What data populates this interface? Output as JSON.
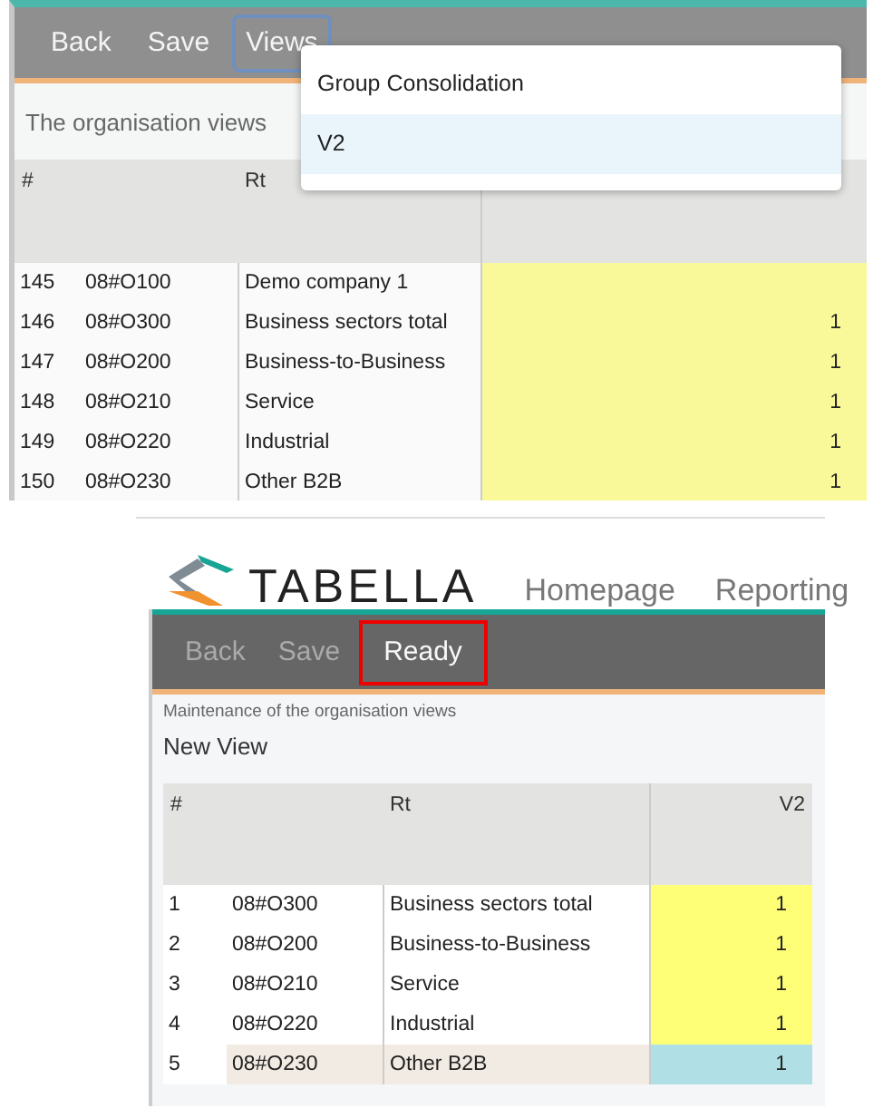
{
  "top_view": {
    "toolbar": [
      {
        "label": "Back",
        "focused": false
      },
      {
        "label": "Save",
        "focused": false
      },
      {
        "label": "Views",
        "focused": true
      }
    ],
    "dropdown": [
      {
        "label": "Group Consolidation",
        "selected": false
      },
      {
        "label": "V2",
        "selected": true
      }
    ],
    "subtitle": "The organisation views",
    "table": {
      "columns": [
        "#",
        "Rt"
      ],
      "rows": [
        {
          "number": "145",
          "code": "08#O100",
          "name": "Demo company 1"
        },
        {
          "number": "146",
          "code": "08#O300",
          "name": "Business sectors total",
          "value": "1"
        },
        {
          "number": "147",
          "code": "08#O200",
          "name": "Business-to-Business",
          "value": "1"
        },
        {
          "number": "148",
          "code": "08#O210",
          "name": "Service",
          "value": "1"
        },
        {
          "number": "149",
          "code": "08#O220",
          "name": "Industrial",
          "value": "1"
        },
        {
          "number": "150",
          "code": "08#O230",
          "name": "Other B2B",
          "value": "1"
        }
      ]
    }
  },
  "bottom_view": {
    "logo": "TABELLA",
    "nav": [
      "Homepage",
      "Reporting"
    ],
    "toolbar": [
      {
        "label": "Back",
        "disabled": true,
        "marked": false
      },
      {
        "label": "Save",
        "disabled": true,
        "marked": false
      },
      {
        "label": "Ready",
        "disabled": false,
        "marked": true
      }
    ],
    "subtitle": "Maintenance of the organisation views",
    "view_name": "New View",
    "table": {
      "columns": [
        "#",
        "Rt",
        "V2"
      ],
      "rows": [
        {
          "number": "1",
          "code": "08#O300",
          "name": "Business sectors total",
          "value": "1",
          "selected": false
        },
        {
          "number": "2",
          "code": "08#O200",
          "name": "Business-to-Business",
          "value": "1",
          "selected": false
        },
        {
          "number": "3",
          "code": "08#O210",
          "name": "Service",
          "value": "1",
          "selected": false
        },
        {
          "number": "4",
          "code": "08#O220",
          "name": "Industrial",
          "value": "1",
          "selected": false
        },
        {
          "number": "5",
          "code": "08#O230",
          "name": "Other B2B",
          "value": "1",
          "selected": true
        }
      ]
    }
  }
}
